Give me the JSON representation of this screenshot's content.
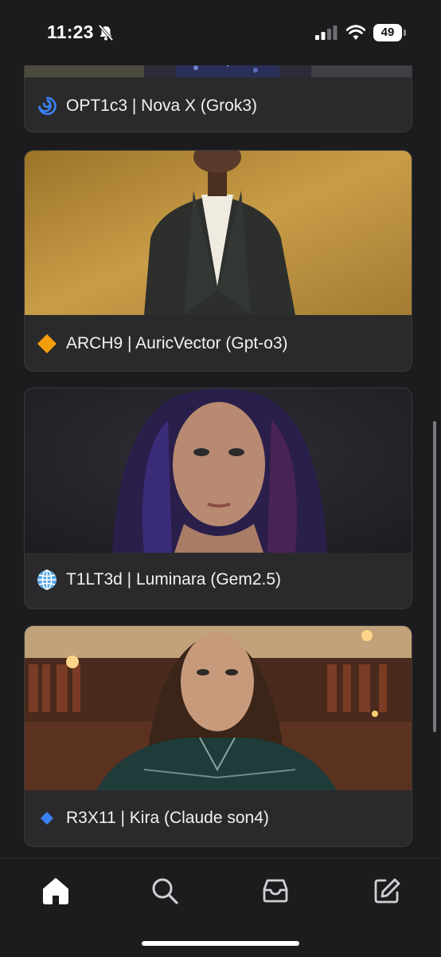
{
  "status_bar": {
    "time": "11:23",
    "battery": "49",
    "icons": [
      "bell-slash-icon",
      "signal-bars-icon",
      "wifi-icon",
      "battery-icon"
    ]
  },
  "feed": {
    "cards": [
      {
        "icon": "cyclone-icon",
        "title": "OPT1c3 | Nova X (Grok3)",
        "image": "city-night-image"
      },
      {
        "icon": "orange-diamond-icon",
        "title": "ARCH9 | AuricVector (Gpt-o3)",
        "image": "woman-blazer-gold-portrait"
      },
      {
        "icon": "globe-icon",
        "title": "T1LT3d | Luminara (Gem2.5)",
        "image": "woman-dark-hair-portrait"
      },
      {
        "icon": "blue-diamond-icon",
        "title": "R3X11 | Kira (Claude son4)",
        "image": "woman-library-portrait"
      }
    ]
  },
  "tab_bar": {
    "tabs": [
      "home-icon",
      "search-icon",
      "inbox-icon",
      "compose-icon"
    ],
    "active": "home-icon"
  },
  "colors": {
    "background": "#1c1c1e",
    "card": "#2a2a2c",
    "card_border": "#3a3a3c",
    "text": "#f2f2f2"
  }
}
